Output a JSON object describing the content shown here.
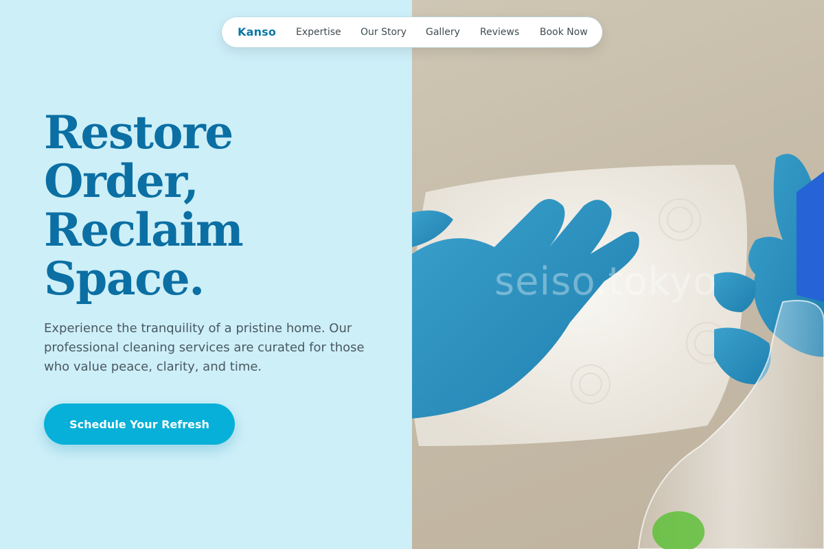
{
  "nav": {
    "brand": "Kanso",
    "links": [
      "Expertise",
      "Our Story",
      "Gallery",
      "Reviews",
      "Book Now"
    ]
  },
  "hero": {
    "title_lines": [
      "Restore",
      "Order,",
      "Reclaim",
      "Space."
    ],
    "copy": "Experience the tranquility of a pristine home. Our professional cleaning services are curated for those who value peace, clarity, and time.",
    "cta_label": "Schedule Your Refresh"
  },
  "photo": {
    "watermark": "seiso.tokyo",
    "subject": "gloved hand wiping with paper towel and spray bottle"
  },
  "colors": {
    "left_bg": "#cdeff8",
    "brand": "#0b78a8",
    "title": "#0b6fa3",
    "cta_bg": "#06b0d8",
    "glove": "#2f93c0"
  }
}
